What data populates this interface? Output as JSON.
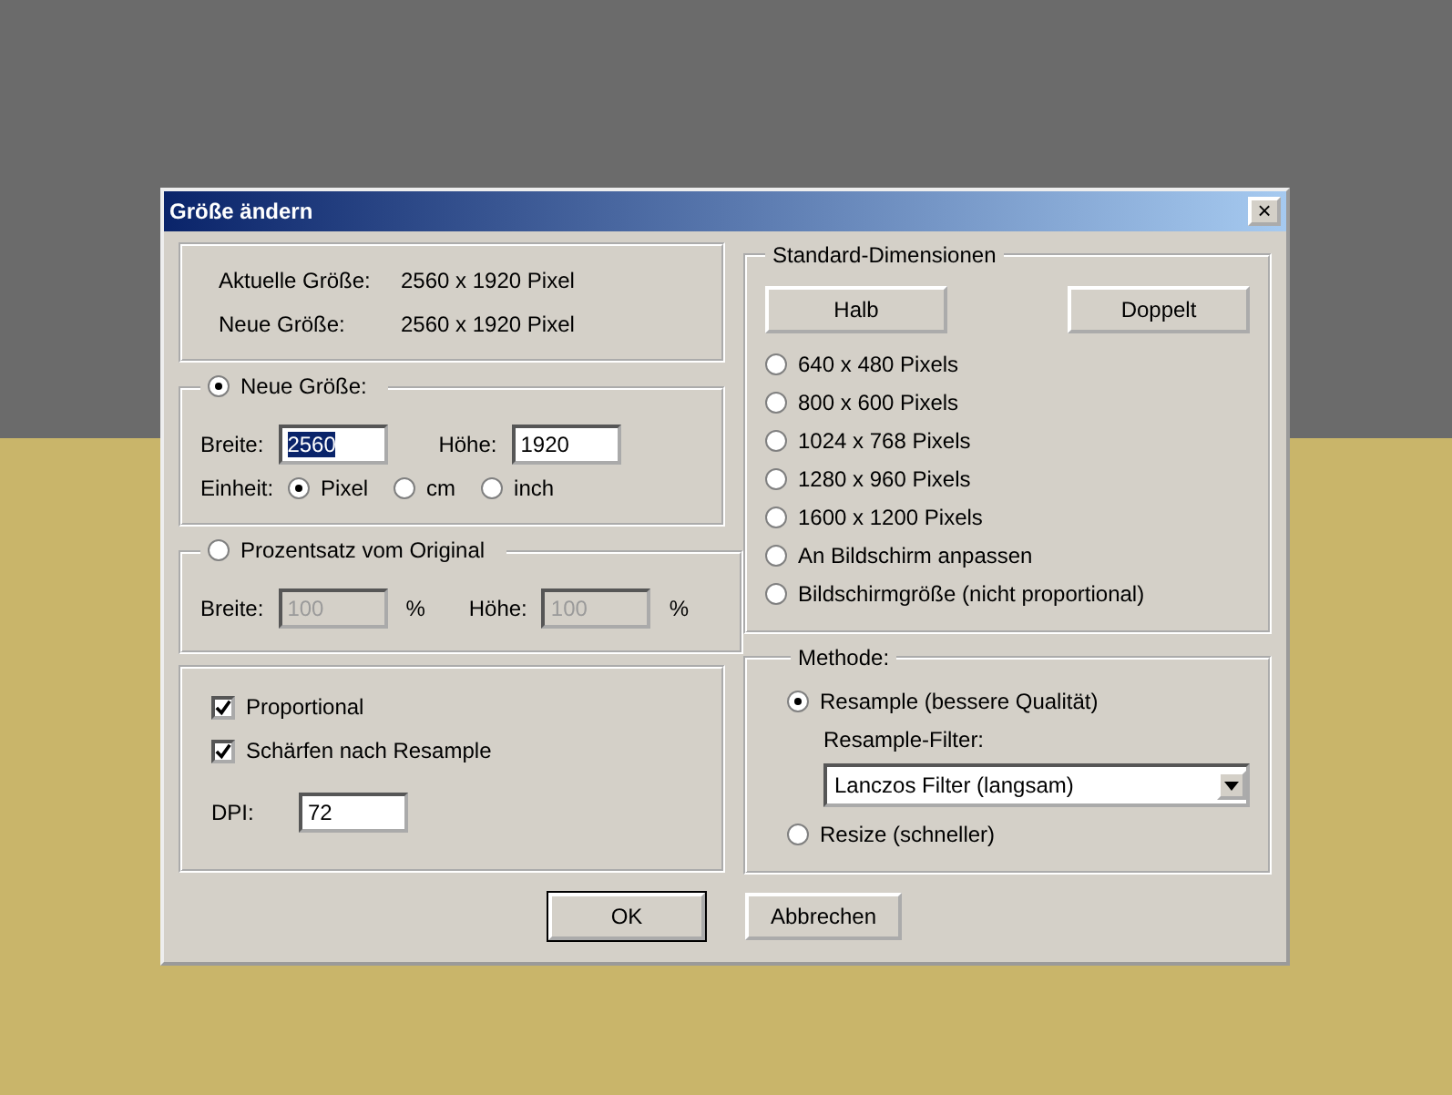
{
  "window": {
    "title": "Größe ändern",
    "close": "×"
  },
  "current": [
    {
      "label": "Aktuelle Größe:",
      "value": "2560  x  1920  Pixel"
    },
    {
      "label": "Neue Größe:",
      "value": "2560  x  1920  Pixel"
    }
  ],
  "new_size": {
    "label": "Neue Größe:",
    "selected": true,
    "fields": [
      {
        "label": "Breite:",
        "value": "2560",
        "highlighted": true,
        "disabled": false
      },
      {
        "label": "Höhe:",
        "value": "1920",
        "highlighted": false,
        "disabled": false
      }
    ],
    "unit_label": "Einheit:",
    "units": [
      {
        "label": "Pixel",
        "selected": true
      },
      {
        "label": "cm",
        "selected": false
      },
      {
        "label": "inch",
        "selected": false
      }
    ]
  },
  "percent": {
    "label": "Prozentsatz vom Original",
    "selected": false,
    "fields": [
      {
        "label": "Breite:",
        "value": "100",
        "unit": "%",
        "disabled": true
      },
      {
        "label": "Höhe:",
        "value": "100",
        "unit": "%",
        "disabled": true
      }
    ]
  },
  "options": [
    {
      "label": "Proportional",
      "checked": true
    },
    {
      "label": "Schärfen nach Resample",
      "checked": true
    }
  ],
  "dpi": {
    "label": "DPI:",
    "value": "72"
  },
  "standard": {
    "title": "Standard-Dimensionen",
    "buttons": [
      "Halb",
      "Doppelt"
    ],
    "sizes": [
      {
        "label": "640 x 480 Pixels",
        "selected": false
      },
      {
        "label": "800 x 600 Pixels",
        "selected": false
      },
      {
        "label": "1024 x 768 Pixels",
        "selected": false
      },
      {
        "label": "1280 x 960 Pixels",
        "selected": false
      },
      {
        "label": "1600 x 1200 Pixels",
        "selected": false
      },
      {
        "label": "An Bildschirm anpassen",
        "selected": false
      },
      {
        "label": "Bildschirmgröße (nicht proportional)",
        "selected": false
      }
    ]
  },
  "method": {
    "title": "Methode:",
    "filter_label": "Resample-Filter:",
    "filter_value": "Lanczos Filter (langsam)",
    "options": [
      {
        "label": "Resample (bessere Qualität)",
        "selected": true,
        "kind": "resample"
      },
      {
        "label": "Resize (schneller)",
        "selected": false,
        "kind": "plain"
      }
    ]
  },
  "buttons": [
    "OK",
    "Abbrechen"
  ]
}
